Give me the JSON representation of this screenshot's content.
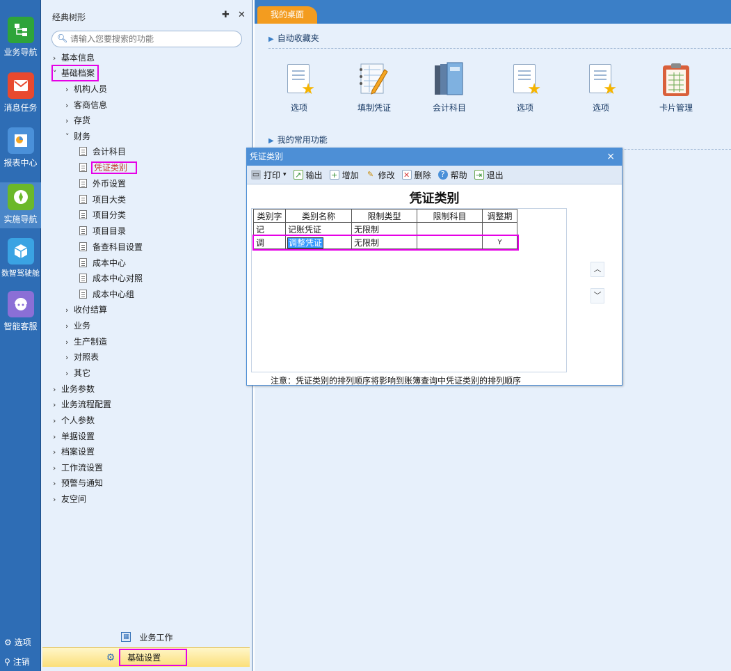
{
  "rail": {
    "items": [
      {
        "label": "业务导航",
        "icon": "sitemap-icon",
        "color": "#2ea43a"
      },
      {
        "label": "消息任务",
        "icon": "mail-icon",
        "color": "#e8492f"
      },
      {
        "label": "报表中心",
        "icon": "report-icon",
        "color": "#4a90d9"
      },
      {
        "label": "实施导航",
        "icon": "compass-icon",
        "color": "#6bb82a"
      },
      {
        "label": "数智驾驶舱",
        "icon": "cube-icon",
        "color": "#3aa3e3"
      },
      {
        "label": "智能客服",
        "icon": "headset-icon",
        "color": "#8b6fd6"
      }
    ],
    "footer": {
      "options": "选项",
      "logout": "注销"
    }
  },
  "tree": {
    "title": "经典树形",
    "search_placeholder": "请输入您要搜索的功能",
    "nodes": [
      {
        "label": "基本信息"
      },
      {
        "label": "基础档案"
      },
      {
        "label": "机构人员"
      },
      {
        "label": "客商信息"
      },
      {
        "label": "存货"
      },
      {
        "label": "财务"
      },
      {
        "label": "会计科目"
      },
      {
        "label": "凭证类别"
      },
      {
        "label": "外币设置"
      },
      {
        "label": "项目大类"
      },
      {
        "label": "项目分类"
      },
      {
        "label": "项目目录"
      },
      {
        "label": "备查科目设置"
      },
      {
        "label": "成本中心"
      },
      {
        "label": "成本中心对照"
      },
      {
        "label": "成本中心组"
      },
      {
        "label": "收付结算"
      },
      {
        "label": "业务"
      },
      {
        "label": "生产制造"
      },
      {
        "label": "对照表"
      },
      {
        "label": "其它"
      },
      {
        "label": "业务参数"
      },
      {
        "label": "业务流程配置"
      },
      {
        "label": "个人参数"
      },
      {
        "label": "单据设置"
      },
      {
        "label": "档案设置"
      },
      {
        "label": "工作流设置"
      },
      {
        "label": "预警与通知"
      },
      {
        "label": "友空间"
      }
    ],
    "bottom_tabs": {
      "business_work": "业务工作",
      "basic_settings": "基础设置"
    }
  },
  "main": {
    "tab": "我的桌面",
    "favorites_title": "自动收藏夹",
    "common_title": "我的常用功能",
    "favorites": [
      {
        "label": "选项",
        "icon": "doc-star-icon"
      },
      {
        "label": "填制凭证",
        "icon": "notebook-pen-icon"
      },
      {
        "label": "会计科目",
        "icon": "books-icon"
      },
      {
        "label": "选项",
        "icon": "doc-star-icon"
      },
      {
        "label": "选项",
        "icon": "doc-star-icon"
      },
      {
        "label": "卡片管理",
        "icon": "clipboard-icon"
      }
    ]
  },
  "dialog": {
    "title": "凭证类别",
    "close": "×",
    "toolbar": {
      "print": "打印",
      "export": "输出",
      "add": "增加",
      "edit": "修改",
      "delete": "删除",
      "help": "帮助",
      "exit": "退出"
    },
    "heading": "凭证类别",
    "columns": [
      "类别字",
      "类别名称",
      "限制类型",
      "限制科目",
      "调整期"
    ],
    "rows": [
      [
        "记",
        "记账凭证",
        "无限制",
        "",
        ""
      ],
      [
        "调",
        "调整凭证",
        "无限制",
        "",
        "Y"
      ]
    ],
    "note": "注意：凭证类别的排列顺序将影响到账簿查询中凭证类别的排列顺序"
  }
}
